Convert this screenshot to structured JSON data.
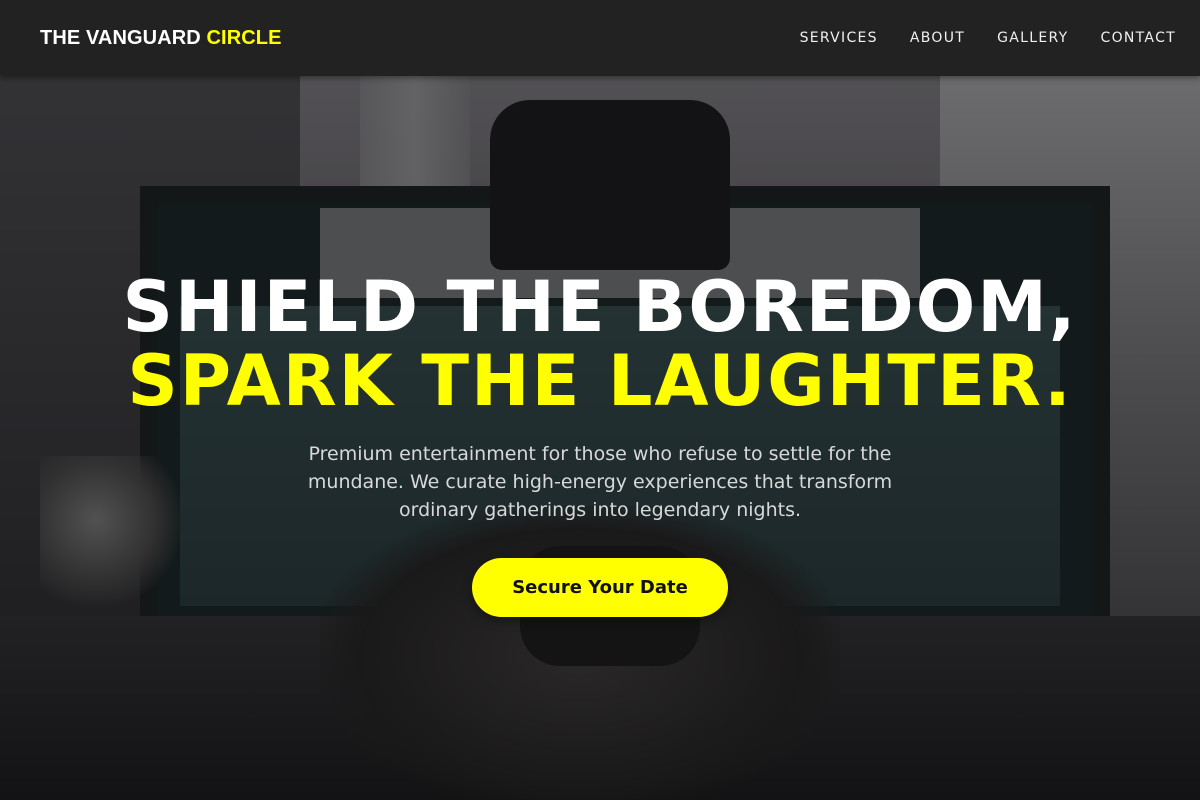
{
  "header": {
    "brand_main": "THE VANGUARD",
    "brand_accent": "CIRCLE",
    "nav": [
      "SERVICES",
      "ABOUT",
      "GALLERY",
      "CONTACT"
    ]
  },
  "hero": {
    "headline_line1": "SHIELD THE BOREDOM,",
    "headline_line2": "SPARK THE LAUGHTER.",
    "subtext": "Premium entertainment for those who refuse to settle for the mundane. We curate high-energy experiences that transform ordinary gatherings into legendary nights.",
    "cta_label": "Secure Your Date"
  },
  "colors": {
    "accent": "#ffff00",
    "header_bg": "#222222",
    "text_light": "#ffffff"
  }
}
